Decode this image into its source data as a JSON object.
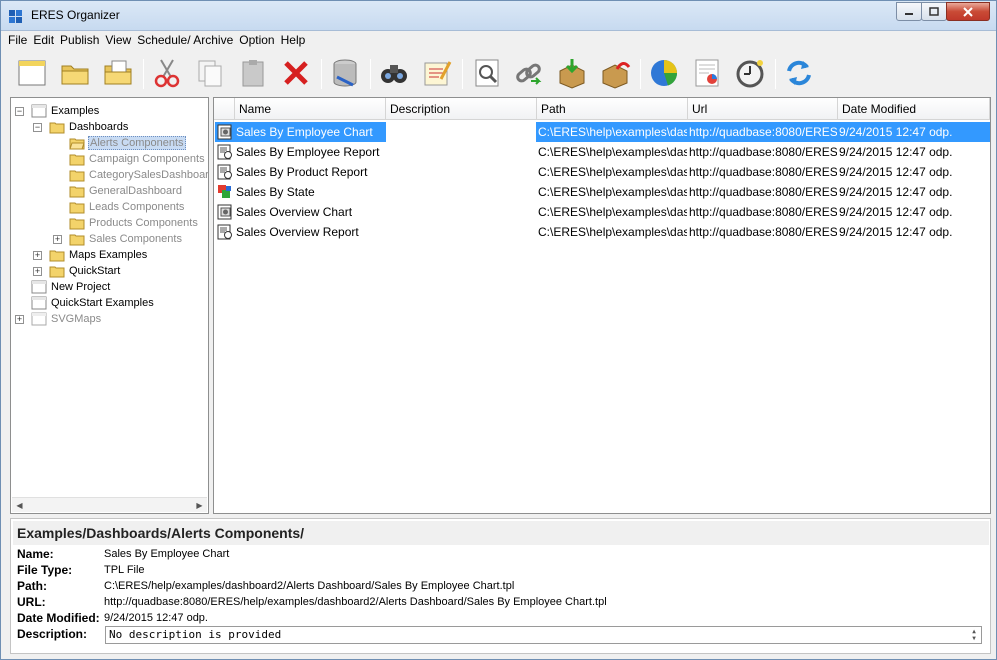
{
  "window": {
    "title": "ERES Organizer",
    "controls": [
      "minimize",
      "maximize",
      "close"
    ]
  },
  "menu": [
    "File",
    "Edit",
    "Publish",
    "View",
    "Schedule/ Archive",
    "Option",
    "Help"
  ],
  "toolbar_icons": [
    "new-icon",
    "open-folder-icon",
    "open-project-icon",
    "cut-icon",
    "copy-icon",
    "paste-icon",
    "delete-icon",
    "database-icon",
    "find-icon",
    "edit-icon",
    "preview-icon",
    "link-icon",
    "import-icon",
    "export-icon",
    "chart-icon",
    "report-icon",
    "schedule-icon",
    "refresh-icon"
  ],
  "tree": {
    "items": [
      {
        "label": "Examples",
        "style": "normal"
      },
      {
        "label": "Dashboards",
        "style": "normal"
      },
      {
        "label": "Alerts Components",
        "style": "selected"
      },
      {
        "label": "Campaign Components",
        "style": "dim"
      },
      {
        "label": "CategorySalesDashboard",
        "style": "dim"
      },
      {
        "label": "GeneralDashboard",
        "style": "dim"
      },
      {
        "label": "Leads Components",
        "style": "dim"
      },
      {
        "label": "Products Components",
        "style": "dim"
      },
      {
        "label": "Sales Components",
        "style": "dim"
      },
      {
        "label": "Maps Examples",
        "style": "normal"
      },
      {
        "label": "QuickStart",
        "style": "normal"
      },
      {
        "label": "New Project",
        "style": "normal"
      },
      {
        "label": "QuickStart Examples",
        "style": "normal"
      },
      {
        "label": "SVGMaps",
        "style": "dim"
      }
    ]
  },
  "list": {
    "columns": [
      "Name",
      "Description",
      "Path",
      "Url",
      "Date Modified"
    ],
    "rows": [
      {
        "name": "Sales By Employee Chart",
        "description": "",
        "path": "C:\\ERES\\help\\examples\\das...",
        "url": "http://quadbase:8080/ERES...",
        "date": "9/24/2015 12:47 odp.",
        "icon": "chart-file-icon"
      },
      {
        "name": "Sales By Employee Report",
        "description": "",
        "path": "C:\\ERES\\help\\examples\\das...",
        "url": "http://quadbase:8080/ERES...",
        "date": "9/24/2015 12:47 odp.",
        "icon": "report-file-icon"
      },
      {
        "name": "Sales By Product Report",
        "description": "",
        "path": "C:\\ERES\\help\\examples\\das...",
        "url": "http://quadbase:8080/ERES...",
        "date": "9/24/2015 12:47 odp.",
        "icon": "report-file-icon"
      },
      {
        "name": "Sales By State",
        "description": "",
        "path": "C:\\ERES\\help\\examples\\das...",
        "url": "http://quadbase:8080/ERES...",
        "date": "9/24/2015 12:47 odp.",
        "icon": "map-file-icon"
      },
      {
        "name": "Sales Overview Chart",
        "description": "",
        "path": "C:\\ERES\\help\\examples\\das...",
        "url": "http://quadbase:8080/ERES...",
        "date": "9/24/2015 12:47 odp.",
        "icon": "chart-file-icon"
      },
      {
        "name": "Sales Overview Report",
        "description": "",
        "path": "C:\\ERES\\help\\examples\\das...",
        "url": "http://quadbase:8080/ERES...",
        "date": "9/24/2015 12:47 odp.",
        "icon": "report-file-icon"
      }
    ]
  },
  "details": {
    "title": "Examples/Dashboards/Alerts Components/",
    "labels": {
      "name": "Name:",
      "file_type": "File Type:",
      "path": "Path:",
      "url": "URL:",
      "date_modified": "Date Modified:",
      "description": "Description:"
    },
    "values": {
      "name": "Sales By Employee Chart",
      "file_type": "TPL File",
      "path": "C:\\ERES/help/examples/dashboard2/Alerts Dashboard/Sales By Employee Chart.tpl",
      "url": "http://quadbase:8080/ERES/help/examples/dashboard2/Alerts Dashboard/Sales By Employee Chart.tpl",
      "date_modified": "9/24/2015 12:47 odp.",
      "description": "No description is provided"
    }
  },
  "colors": {
    "selection": "#3399ff",
    "tree_selection": "#c8dbf3",
    "titlebar": "#c7daf0"
  }
}
